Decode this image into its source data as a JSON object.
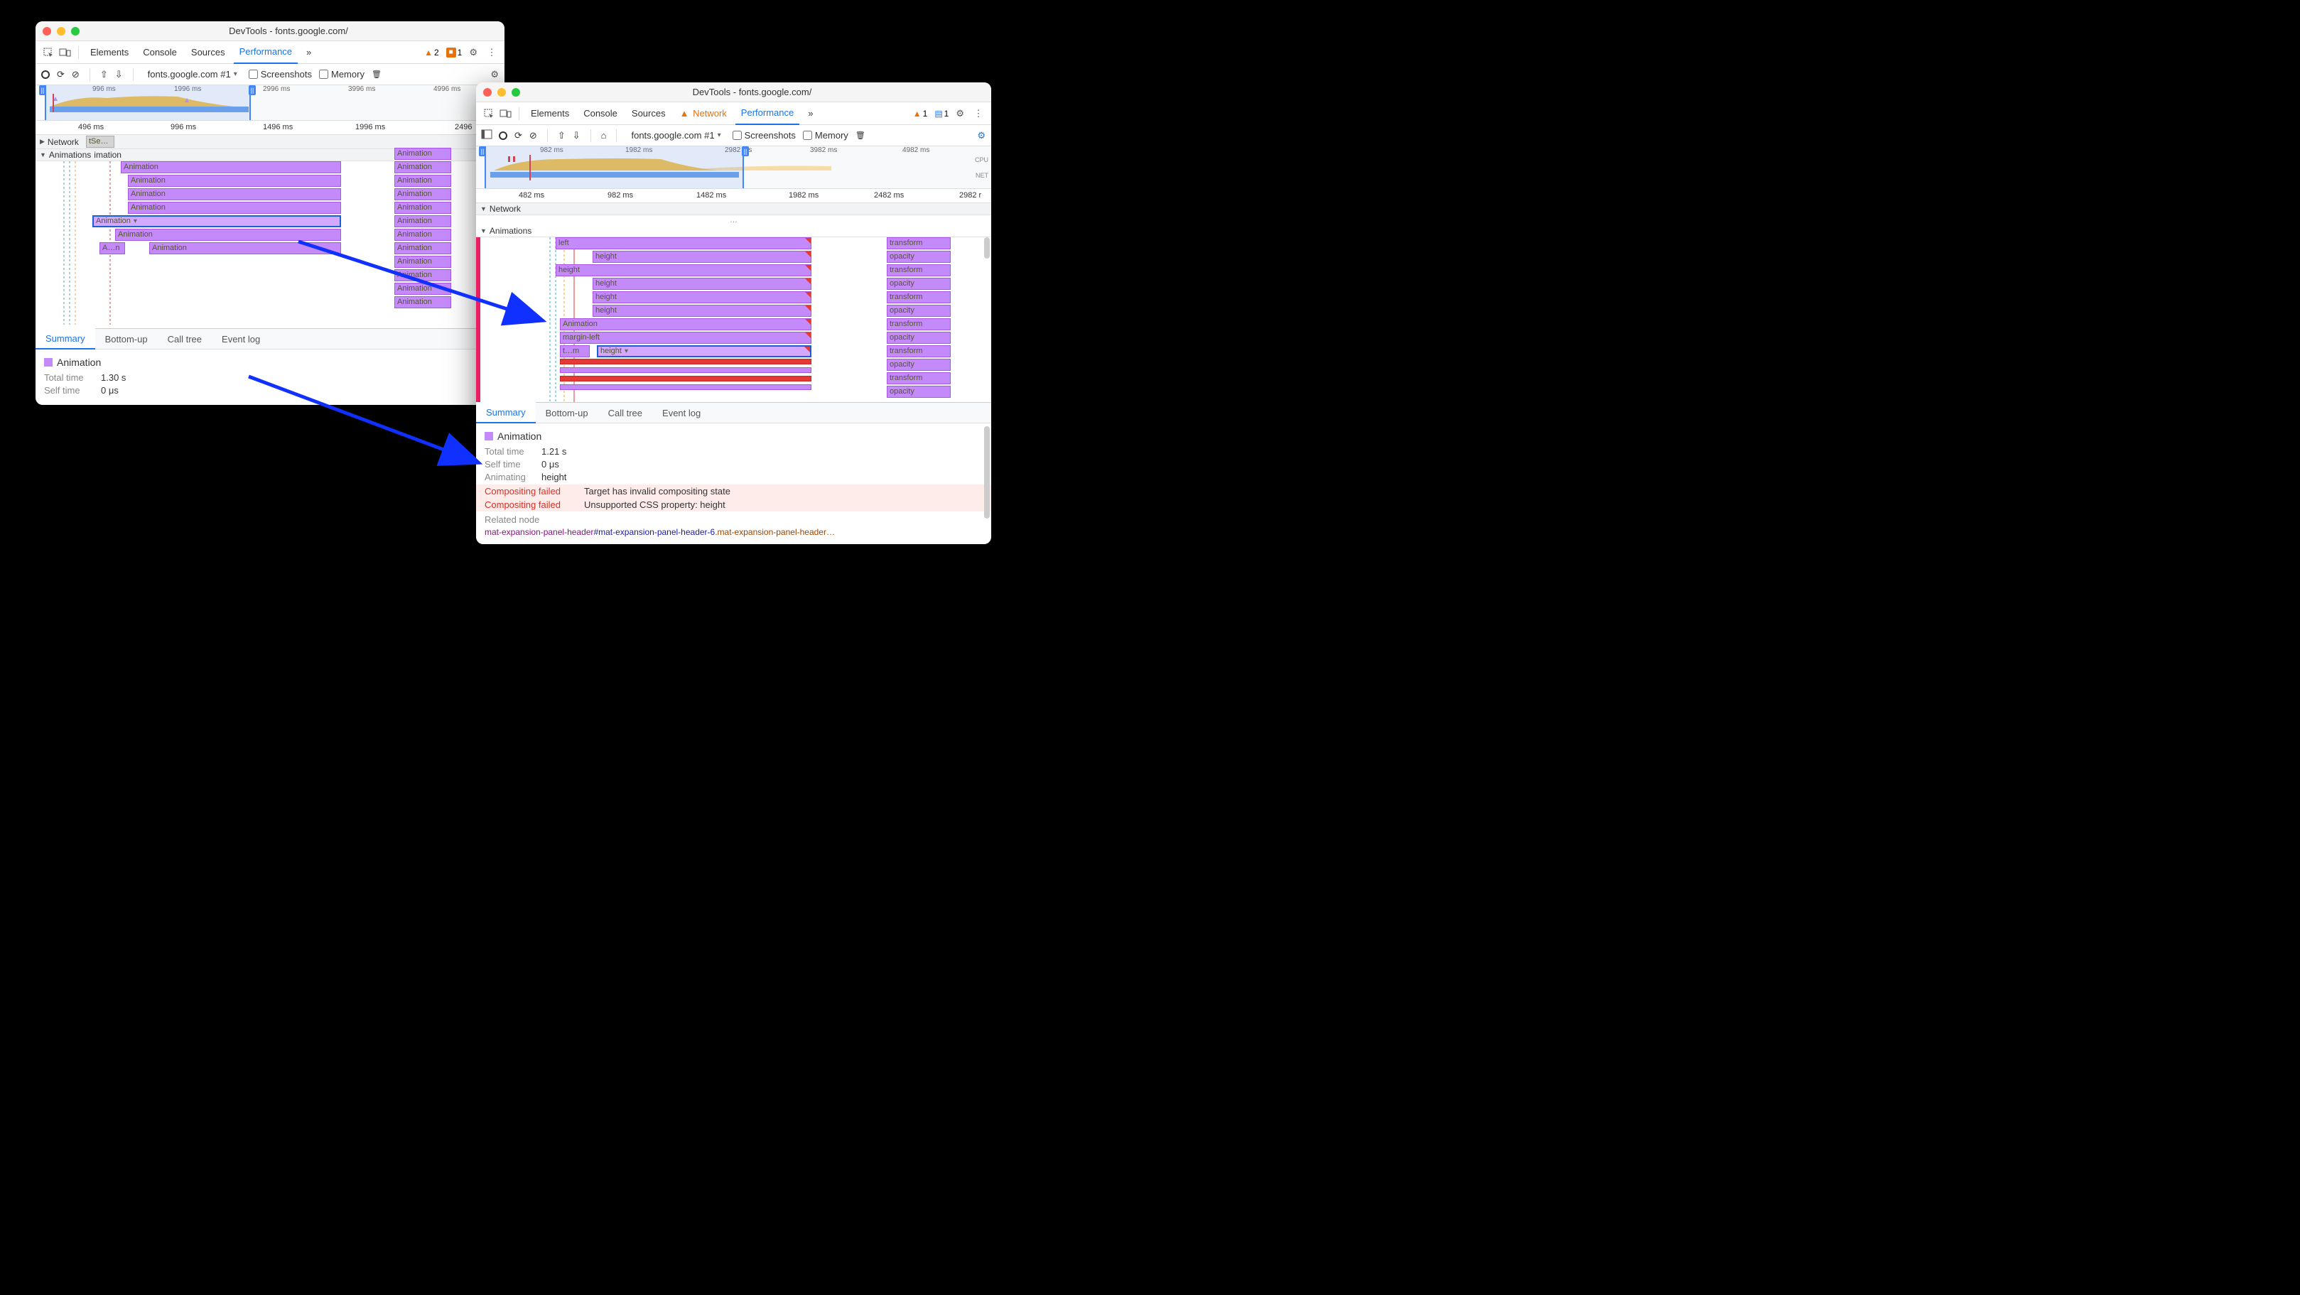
{
  "window1": {
    "title": "DevTools - fonts.google.com/",
    "tabs": {
      "elements": "Elements",
      "console": "Console",
      "sources": "Sources",
      "performance": "Performance",
      "more": "»"
    },
    "badges": {
      "warn": "2",
      "issue": "1"
    },
    "toolbar": {
      "target": "fonts.google.com #1",
      "screenshots": "Screenshots",
      "memory": "Memory"
    },
    "overview_ticks": [
      "996 ms",
      "1996 ms",
      "2996 ms",
      "3996 ms",
      "4996 ms"
    ],
    "ruler_ticks": [
      "496 ms",
      "996 ms",
      "1496 ms",
      "1996 ms",
      "2496"
    ],
    "tracks": {
      "network": "Network",
      "network_item": "tSe…",
      "animations": "Animations",
      "anim_sub": "imation"
    },
    "bars_left": [
      "Animation",
      "Animation",
      "Animation",
      "Animation",
      "Animation",
      "Animation",
      "A…n",
      "Animation"
    ],
    "bars_right": [
      "Animation",
      "Animation",
      "Animation",
      "Animation",
      "Animation",
      "Animation",
      "Animation",
      "Animation",
      "Animation",
      "Animation",
      "Animation",
      "Animation"
    ],
    "detail_tabs": {
      "summary": "Summary",
      "bottomup": "Bottom-up",
      "calltree": "Call tree",
      "eventlog": "Event log"
    },
    "summary": {
      "title": "Animation",
      "total_lbl": "Total time",
      "total": "1.30 s",
      "self_lbl": "Self time",
      "self": "0 μs"
    }
  },
  "window2": {
    "title": "DevTools - fonts.google.com/",
    "tabs": {
      "elements": "Elements",
      "console": "Console",
      "sources": "Sources",
      "network": "Network",
      "performance": "Performance",
      "more": "»"
    },
    "badges": {
      "warn": "1",
      "msg": "1"
    },
    "toolbar": {
      "target": "fonts.google.com #1",
      "screenshots": "Screenshots",
      "memory": "Memory"
    },
    "overview_ticks": [
      "982 ms",
      "1982 ms",
      "2982 ms",
      "3982 ms",
      "4982 ms"
    ],
    "overview_side": {
      "cpu": "CPU",
      "net": "NET"
    },
    "ruler_ticks": [
      "482 ms",
      "982 ms",
      "1482 ms",
      "1982 ms",
      "2482 ms",
      "2982 r"
    ],
    "tracks": {
      "network": "Network",
      "animations": "Animations"
    },
    "col_ellipsis": "…",
    "left_bars": [
      {
        "txt": "left",
        "indent": 0
      },
      {
        "txt": "height",
        "indent": 1
      },
      {
        "txt": "height",
        "indent": 0
      },
      {
        "txt": "height",
        "indent": 1
      },
      {
        "txt": "height",
        "indent": 1
      },
      {
        "txt": "height",
        "indent": 1
      },
      {
        "txt": "Animation",
        "indent": 0
      },
      {
        "txt": "margin-left",
        "indent": 0
      },
      {
        "txt": "t…m",
        "indent": 0
      },
      {
        "txt": "height",
        "indent": 1,
        "sel": true
      }
    ],
    "right_bars": [
      "transform",
      "opacity",
      "transform",
      "opacity",
      "transform",
      "opacity",
      "transform",
      "opacity",
      "transform",
      "opacity",
      "transform",
      "opacity"
    ],
    "detail_tabs": {
      "summary": "Summary",
      "bottomup": "Bottom-up",
      "calltree": "Call tree",
      "eventlog": "Event log"
    },
    "summary": {
      "title": "Animation",
      "total_lbl": "Total time",
      "total": "1.21 s",
      "self_lbl": "Self time",
      "self": "0 μs",
      "anim_lbl": "Animating",
      "anim": "height",
      "cf_lbl": "Compositing failed",
      "cf1": "Target has invalid compositing state",
      "cf2": "Unsupported CSS property: height",
      "related_lbl": "Related node",
      "node_tag": "mat-expansion-panel-header",
      "node_id": "#mat-expansion-panel-header-6",
      "node_cls": ".mat-expansion-panel-header…"
    }
  }
}
